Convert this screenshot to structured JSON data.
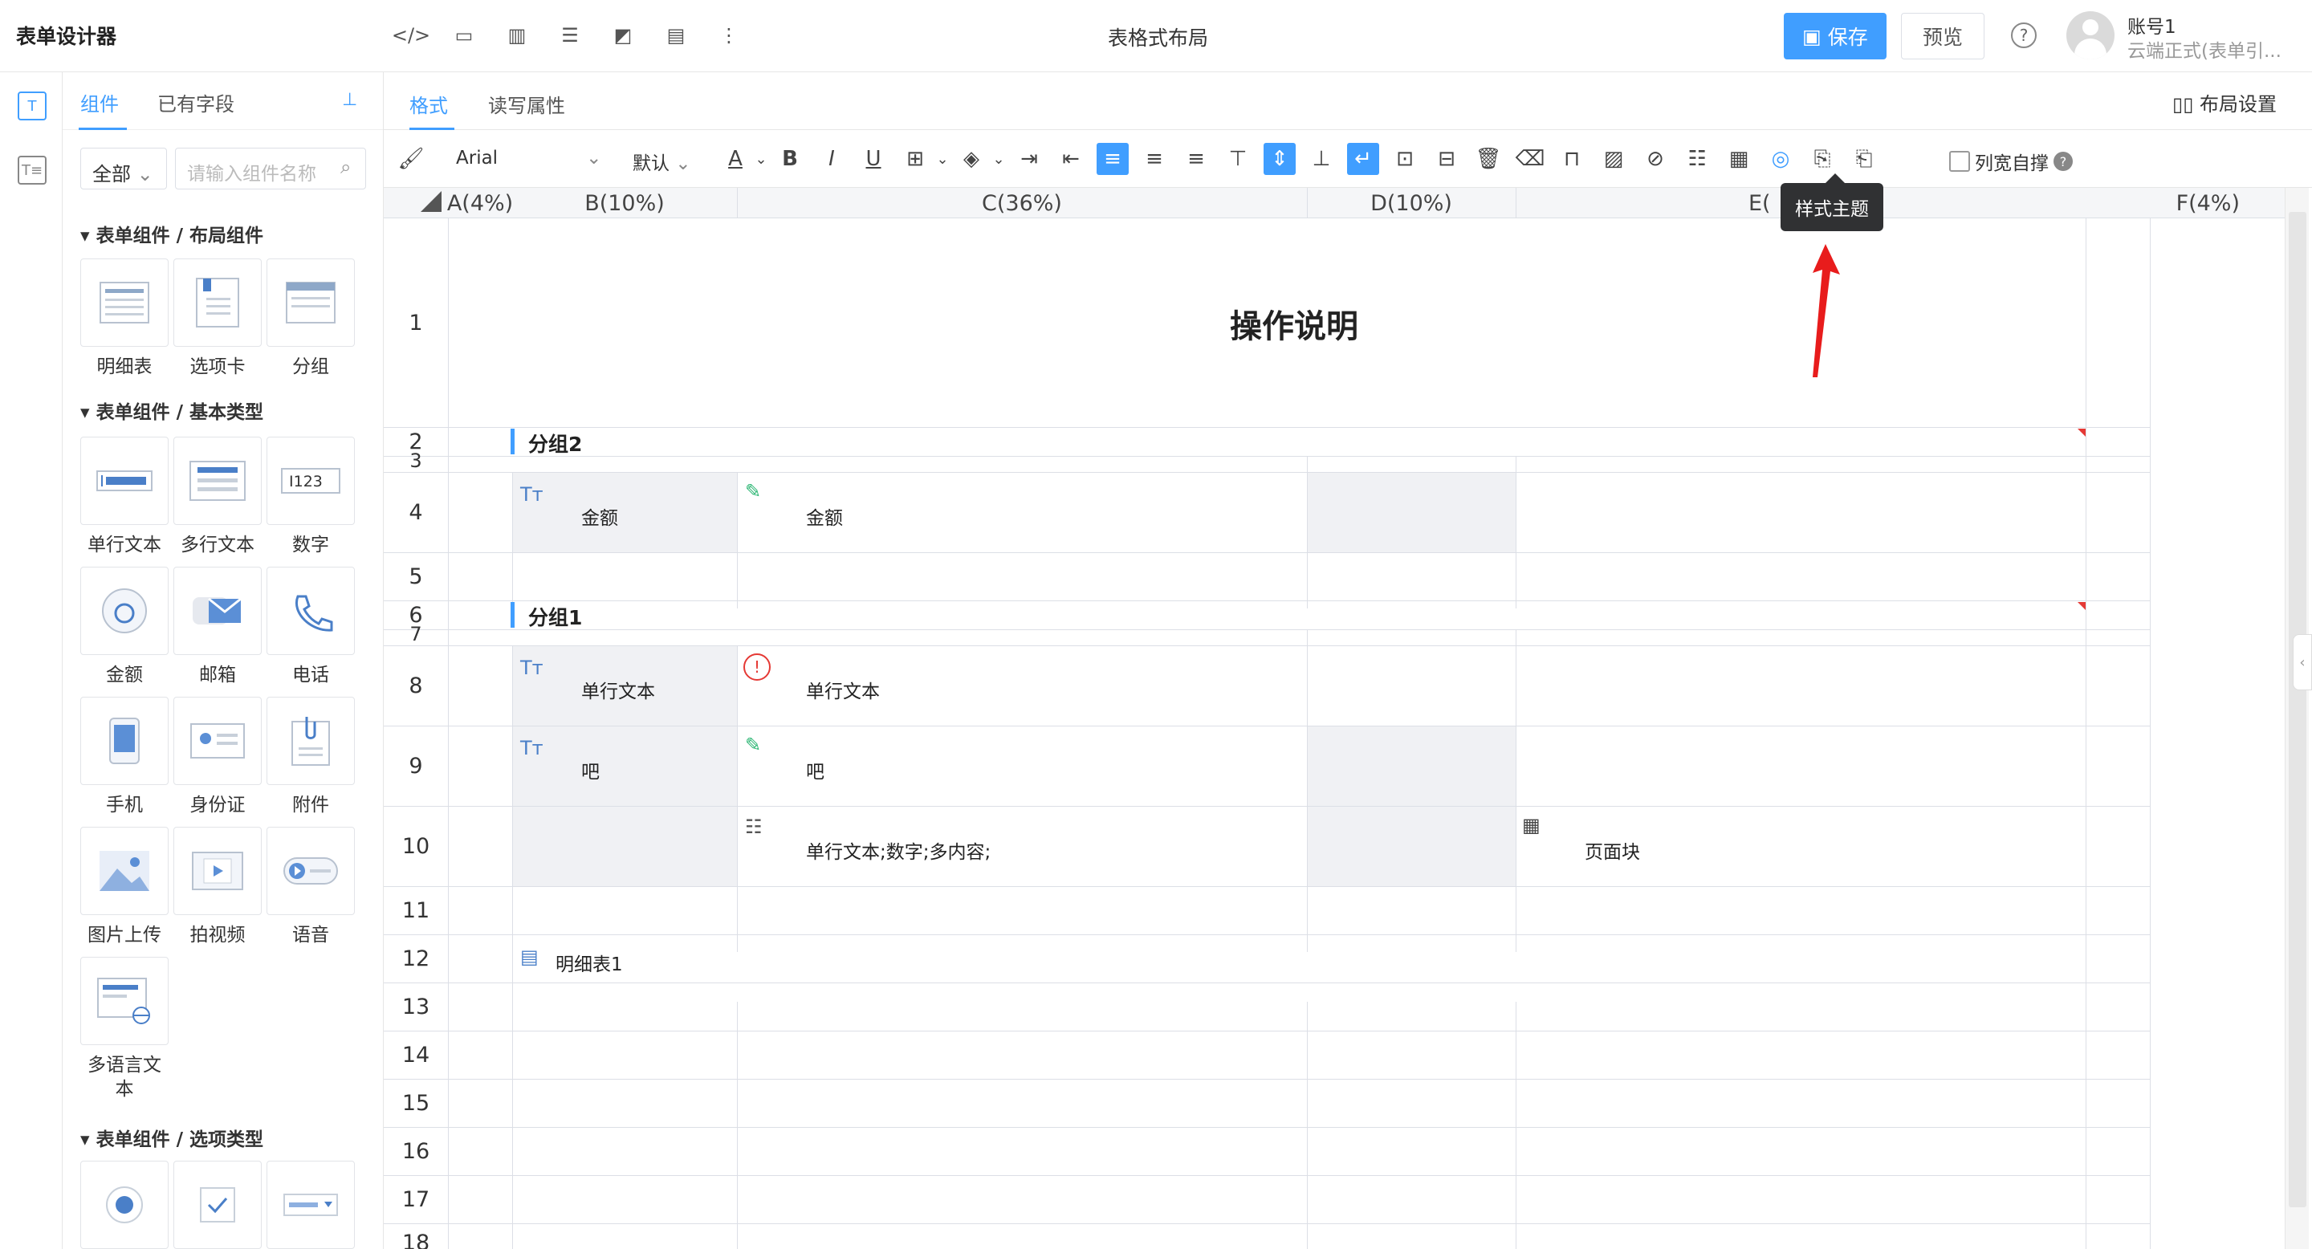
{
  "app": {
    "title": "表单设计器",
    "center_title": "表格式布局"
  },
  "toolbar_icons": [
    "code-icon",
    "screen-icon",
    "layout-icon",
    "database-icon",
    "chart-icon",
    "document-icon",
    "more-icon"
  ],
  "header": {
    "save_label": "保存",
    "preview_label": "预览",
    "help": "?",
    "account_name": "账号1",
    "account_sub": "云端正式(表单引..."
  },
  "panel": {
    "tabs": [
      "组件",
      "已有字段"
    ],
    "filter_value": "全部",
    "search_placeholder": "请输入组件名称",
    "sections": [
      {
        "title": "表单组件 / 布局组件",
        "items": [
          "明细表",
          "选项卡",
          "分组"
        ]
      },
      {
        "title": "表单组件 / 基本类型",
        "items": [
          "单行文本",
          "多行文本",
          "数字",
          "金额",
          "邮箱",
          "电话",
          "手机",
          "身份证",
          "附件",
          "图片上传",
          "拍视频",
          "语音",
          "多语言文本"
        ]
      },
      {
        "title": "表单组件 / 选项类型",
        "items": [
          "",
          "",
          ""
        ]
      }
    ]
  },
  "design": {
    "tabs": [
      "格式",
      "读写属性"
    ],
    "layout_settings": "布局设置",
    "font": "Arial",
    "size": "默认",
    "col_width_auto": "列宽自撑",
    "tooltip": "样式主题"
  },
  "sheet": {
    "columns": [
      "A(4%)",
      "B(10%)",
      "C(36%)",
      "D(10%)",
      "E(",
      "F(4%)"
    ],
    "rows": [
      "1",
      "2",
      "3",
      "4",
      "5",
      "6",
      "7",
      "8",
      "9",
      "10",
      "11",
      "12",
      "13",
      "14",
      "15",
      "16",
      "17",
      "18"
    ],
    "title": "操作说明",
    "group2": "分组2",
    "group1": "分组1",
    "r4_label": "金额",
    "r4_value": "金额",
    "r8_label": "单行文本",
    "r8_value": "单行文本",
    "r9_label": "吧",
    "r9_value": "吧",
    "r10_value": "单行文本;数字;多内容;",
    "r10_e": "页面块",
    "r12": "明细表1"
  },
  "colors": {
    "accent": "#409eff",
    "gray_cell": "#f0f1f4",
    "error": "#e53935",
    "edit": "#2bb673"
  }
}
